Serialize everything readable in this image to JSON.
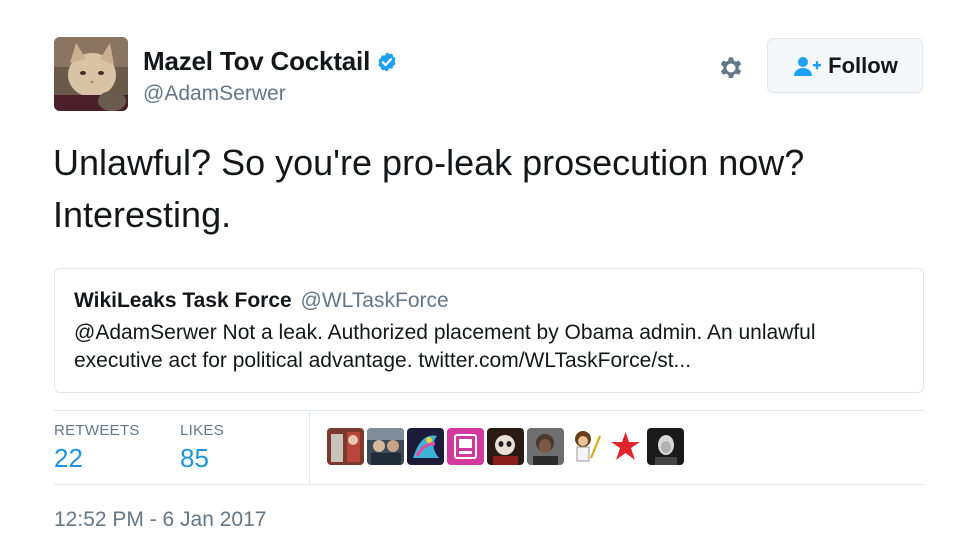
{
  "author": {
    "display_name": "Mazel Tov Cocktail",
    "handle": "@AdamSerwer",
    "verified": true,
    "avatar_icon": "cat-avatar-photo"
  },
  "actions": {
    "settings_icon": "gear-icon",
    "follow_label": "Follow",
    "follow_icon": "add-user-icon"
  },
  "tweet": {
    "text": "Unlawful? So you're pro-leak prosecution now? Interesting."
  },
  "quoted_tweet": {
    "display_name": "WikiLeaks Task Force",
    "handle": "@WLTaskForce",
    "text": "@AdamSerwer Not a leak. Authorized placement by Obama admin. An unlawful executive act for political advantage. twitter.com/WLTaskForce/st..."
  },
  "stats": {
    "retweets_label": "RETWEETS",
    "retweets_value": "22",
    "likes_label": "LIKES",
    "likes_value": "85"
  },
  "likers": [
    "liker-avatar-1",
    "liker-avatar-2",
    "liker-avatar-3",
    "liker-avatar-4",
    "liker-avatar-5",
    "liker-avatar-6",
    "liker-avatar-7",
    "liker-avatar-8",
    "liker-avatar-9"
  ],
  "timestamp": "12:52 PM - 6 Jan 2017",
  "colors": {
    "link_blue": "#1b95e0",
    "verified_blue": "#1da1f2",
    "secondary_text": "#657786",
    "border": "#e1e8ed"
  }
}
